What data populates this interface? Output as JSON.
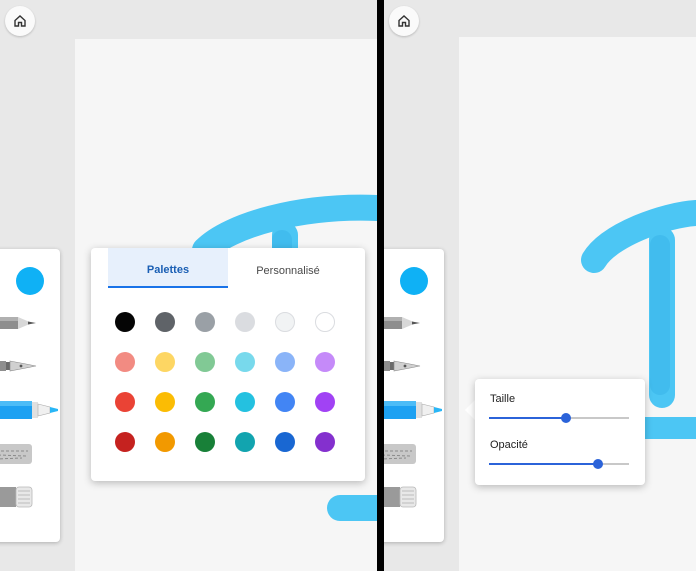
{
  "accent_color": "#1da1f2",
  "ink_color": "#4cc6f4",
  "left_panel": {
    "home_icon": "home-icon",
    "selected_color": "#0fb1f5",
    "tools": [
      "pencil-icon",
      "fountain-pen-icon",
      "highlighter-icon",
      "eraser-icon",
      "stroke-eraser-icon"
    ],
    "color_popup": {
      "tabs": [
        {
          "label": "Palettes",
          "active": true
        },
        {
          "label": "Personnalisé",
          "active": false
        }
      ],
      "swatches": [
        [
          "#050505",
          "#5f6368",
          "#9aa0a6",
          "#dadce0",
          "#f1f3f4",
          "#ffffff"
        ],
        [
          "#f28b82",
          "#fdd663",
          "#81c995",
          "#78d9ec",
          "#8ab4f8",
          "#c58af9"
        ],
        [
          "#ea4335",
          "#fbbc04",
          "#34a853",
          "#24c1e0",
          "#4285f4",
          "#a142f4"
        ],
        [
          "#c5221f",
          "#f29900",
          "#188038",
          "#12a4af",
          "#1967d2",
          "#8430ce"
        ]
      ]
    }
  },
  "right_panel": {
    "home_icon": "home-icon",
    "selected_color": "#0fb1f5",
    "tools": [
      "pencil-icon",
      "fountain-pen-icon",
      "highlighter-icon",
      "eraser-icon",
      "stroke-eraser-icon"
    ],
    "settings_popup": {
      "size_label": "Taille",
      "size_value": 0.55,
      "opacity_label": "Opacité",
      "opacity_value": 0.78
    }
  }
}
